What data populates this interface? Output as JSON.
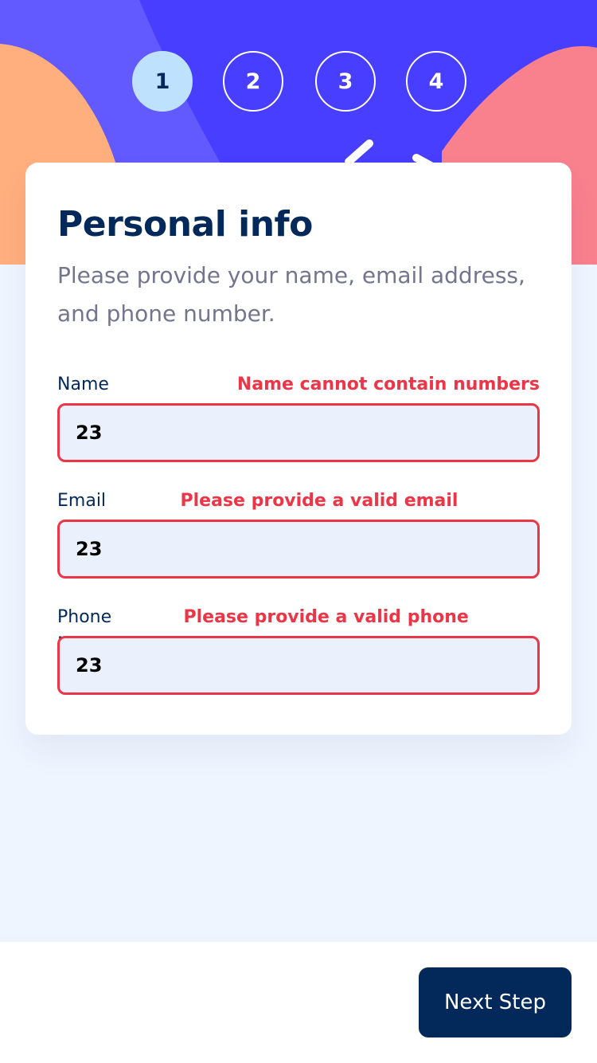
{
  "colors": {
    "header_blue": "#483eff",
    "light_purple": "#6259ff",
    "orange": "#ffaf7e",
    "pink": "#f9818e",
    "active_step": "#bee2fd",
    "marine": "#02295a",
    "error": "#ed3548",
    "input_bg": "#eaf1fd",
    "page_bg": "#eff5ff"
  },
  "steps": [
    {
      "number": "1",
      "active": true
    },
    {
      "number": "2",
      "active": false
    },
    {
      "number": "3",
      "active": false
    },
    {
      "number": "4",
      "active": false
    }
  ],
  "form": {
    "title": "Personal info",
    "subtitle": "Please provide your name, email address, and phone number.",
    "fields": [
      {
        "label": "Name",
        "error": "Name cannot contain numbers",
        "value": "23"
      },
      {
        "label": "Email Address",
        "error": "Please provide a valid email address",
        "value": "23"
      },
      {
        "label": "Phone Number",
        "error": "Please provide a valid phone number",
        "value": "23"
      }
    ]
  },
  "footer": {
    "next_label": "Next Step"
  }
}
